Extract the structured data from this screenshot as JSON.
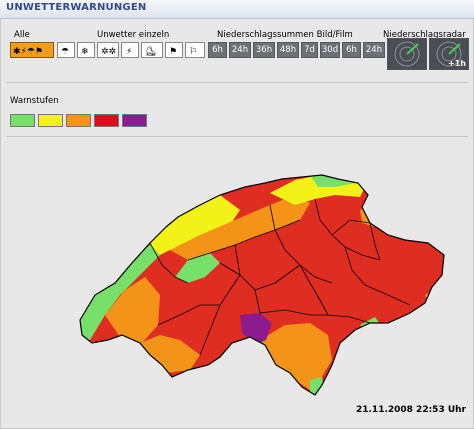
{
  "header": {
    "title": "UNWETTERWARNUNGEN"
  },
  "toolbar": {
    "label_alle": "Alle",
    "label_einzeln": "Unwetter einzeln",
    "label_niederschlag": "Niederschlagssummen Bild/Film",
    "label_radar": "Niederschlagsradar",
    "time_buttons": [
      "6h",
      "24h",
      "36h",
      "48h",
      "7d",
      "30d",
      "6h",
      "24h"
    ],
    "radar_plus": "+1h"
  },
  "legend": {
    "title": "Warnstufen",
    "colors": [
      "#76e06a",
      "#f2f218",
      "#f39418",
      "#d8101e",
      "#8c1c8e"
    ]
  },
  "map": {
    "region_colors": {
      "green": "#76e06a",
      "yellow": "#f2f218",
      "orange": "#f39418",
      "red": "#e02d22",
      "purple": "#8c1c8e"
    }
  },
  "footer": {
    "timestamp": "21.11.2008 22:53 Uhr"
  }
}
